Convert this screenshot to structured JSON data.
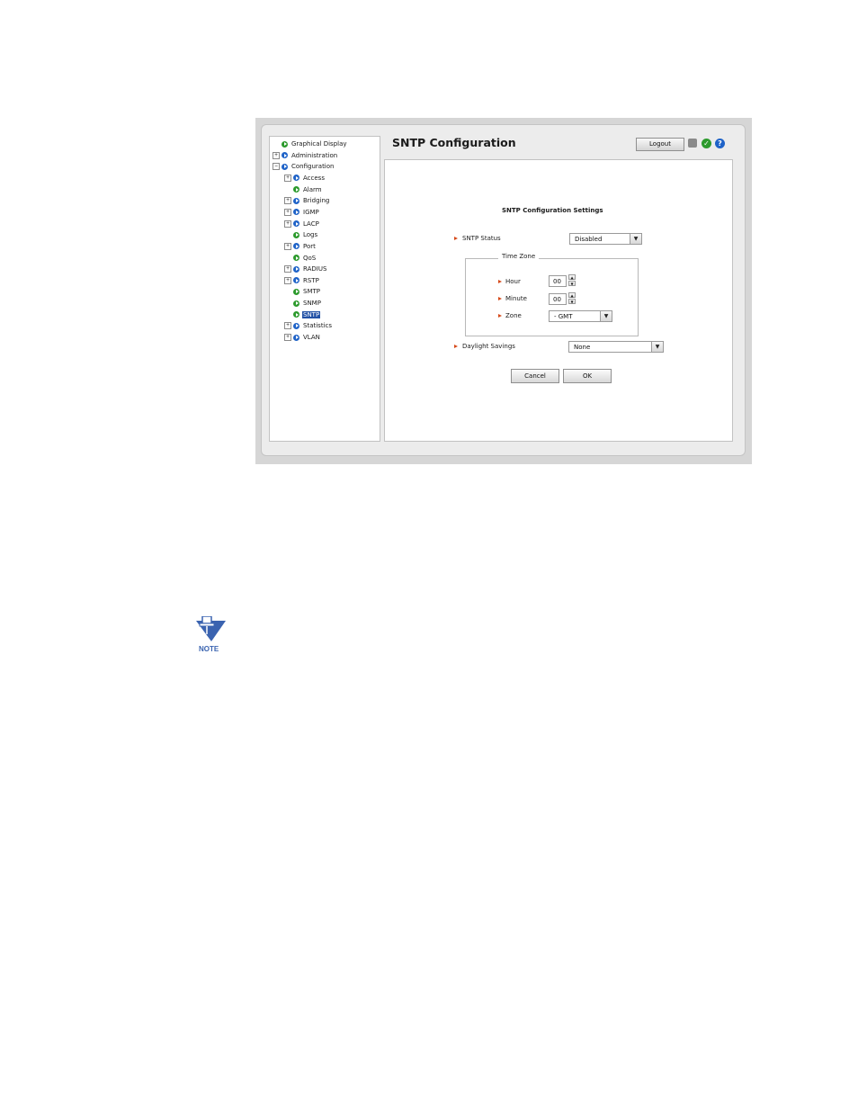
{
  "window": {
    "title": "SNTP Configuration"
  },
  "toolbar": {
    "logout_label": "Logout",
    "save_icon": "save-icon",
    "apply_icon": "check-icon",
    "help_icon": "help-icon",
    "help_glyph": "?",
    "apply_glyph": "✓"
  },
  "tree": {
    "items": [
      {
        "label": "Graphical Display",
        "expander": "",
        "icon": "green"
      },
      {
        "label": "Administration",
        "expander": "+",
        "icon": "blue"
      },
      {
        "label": "Configuration",
        "expander": "−",
        "icon": "blue"
      },
      {
        "label": "Access",
        "expander": "+",
        "icon": "blue"
      },
      {
        "label": "Alarm",
        "expander": "",
        "icon": "green"
      },
      {
        "label": "Bridging",
        "expander": "+",
        "icon": "blue"
      },
      {
        "label": "IGMP",
        "expander": "+",
        "icon": "blue"
      },
      {
        "label": "LACP",
        "expander": "+",
        "icon": "blue"
      },
      {
        "label": "Logs",
        "expander": "",
        "icon": "green"
      },
      {
        "label": "Port",
        "expander": "+",
        "icon": "blue"
      },
      {
        "label": "QoS",
        "expander": "",
        "icon": "green"
      },
      {
        "label": "RADIUS",
        "expander": "+",
        "icon": "blue"
      },
      {
        "label": "RSTP",
        "expander": "+",
        "icon": "blue"
      },
      {
        "label": "SMTP",
        "expander": "",
        "icon": "green"
      },
      {
        "label": "SNMP",
        "expander": "",
        "icon": "green"
      },
      {
        "label": "SNTP",
        "expander": "",
        "icon": "green",
        "selected": true
      },
      {
        "label": "Statistics",
        "expander": "+",
        "icon": "blue"
      },
      {
        "label": "VLAN",
        "expander": "+",
        "icon": "blue"
      }
    ]
  },
  "form": {
    "section_title": "SNTP Configuration Settings",
    "sntp_status_label": "SNTP Status",
    "sntp_status_value": "Disabled",
    "time_zone_legend": "Time Zone",
    "hour_label": "Hour",
    "hour_value": "00",
    "minute_label": "Minute",
    "minute_value": "00",
    "zone_label": "Zone",
    "zone_value": "- GMT",
    "daylight_label": "Daylight Savings",
    "daylight_value": "None",
    "cancel_label": "Cancel",
    "ok_label": "OK",
    "dropdown_glyph": "▼",
    "spin_up_glyph": "▲",
    "spin_down_glyph": "▼"
  },
  "note": {
    "label": "NOTE",
    "icon": "note-icon"
  },
  "colors": {
    "selected": "#2452a6",
    "accent_arrow": "#d64a1a",
    "note": "#3a63b0"
  }
}
